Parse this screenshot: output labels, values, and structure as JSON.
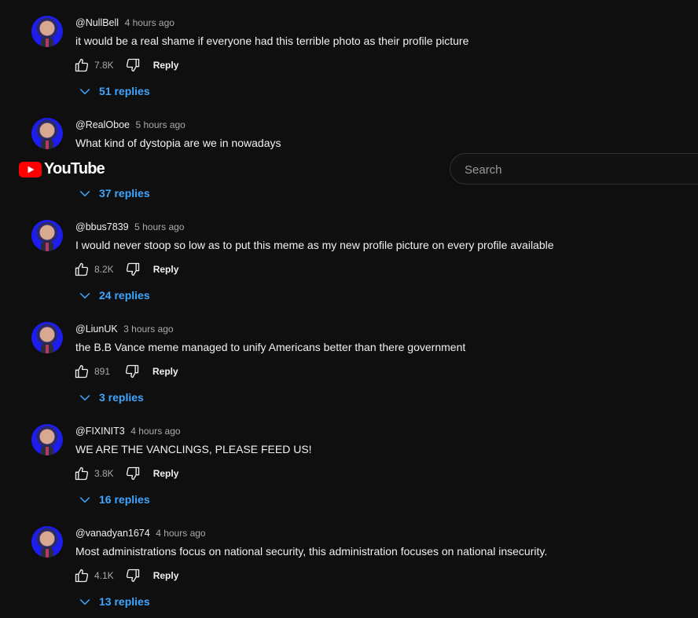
{
  "header": {
    "logo_text": "YouTube",
    "search_placeholder": "Search"
  },
  "comments": [
    {
      "handle": "@NullBell",
      "time": "4 hours ago",
      "text": "it would be a real shame if everyone had this terrible photo as their profile picture",
      "likes": "7.8K",
      "reply_label": "Reply",
      "replies": "51 replies"
    },
    {
      "handle": "@RealOboe",
      "time": "5 hours ago",
      "text": "What kind of dystopia are we in nowadays",
      "likes": "",
      "reply_label": "Reply",
      "replies": "37 replies"
    },
    {
      "handle": "@bbus7839",
      "time": "5 hours ago",
      "text": "I would never stoop so low as to put this meme as my new profile picture on every profile available",
      "likes": "8.2K",
      "reply_label": "Reply",
      "replies": "24 replies"
    },
    {
      "handle": "@LiunUK",
      "time": "3 hours ago",
      "text": "the B.B Vance meme managed to unify Americans better than there government",
      "likes": "891",
      "reply_label": "Reply",
      "replies": "3 replies"
    },
    {
      "handle": "@FIXINIT3",
      "time": "4 hours ago",
      "text": "WE ARE THE VANCLINGS, PLEASE FEED US!",
      "likes": "3.8K",
      "reply_label": "Reply",
      "replies": "16 replies"
    },
    {
      "handle": "@vanadyan1674",
      "time": "4 hours ago",
      "text": "Most administrations focus on national security, this administration focuses on national insecurity.",
      "likes": "4.1K",
      "reply_label": "Reply",
      "replies": "13 replies"
    }
  ],
  "colors": {
    "background": "#0f0f0f",
    "link": "#3ea6ff",
    "secondary": "#aaaaaa",
    "brand": "#ff0000"
  }
}
